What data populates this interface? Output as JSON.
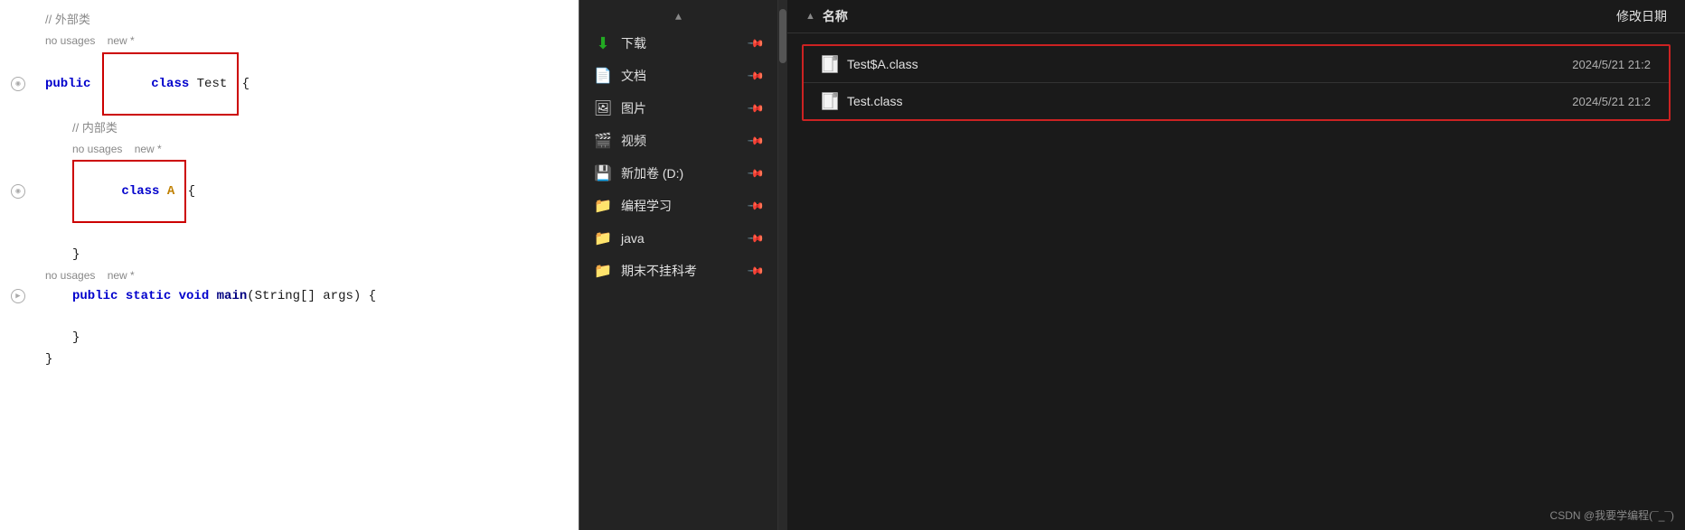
{
  "editor": {
    "lines": [
      {
        "id": 1,
        "type": "comment",
        "text": "// 外部类",
        "indent": 0
      },
      {
        "id": 2,
        "type": "hint",
        "text": "no usages   new *"
      },
      {
        "id": 3,
        "type": "code-public-class",
        "text_before": "public ",
        "keyword_class": "class",
        "class_name": " Test ",
        "highlight_class": true,
        "text_after": "{",
        "indent": 0
      },
      {
        "id": 4,
        "type": "comment-inner",
        "text": "// 内部类",
        "indent": 1
      },
      {
        "id": 5,
        "type": "hint",
        "text": "no usages   new *"
      },
      {
        "id": 6,
        "type": "inner-class",
        "keyword_class": "class",
        "class_name": " A ",
        "highlight": true,
        "text_after": "{",
        "indent": 1
      },
      {
        "id": 7,
        "type": "empty",
        "indent": 0
      },
      {
        "id": 8,
        "type": "closing",
        "text": "}",
        "indent": 1
      },
      {
        "id": 9,
        "type": "hint",
        "text": "no usages   new *"
      },
      {
        "id": 10,
        "type": "main-method",
        "text": "public static void main(String[] args) {",
        "indent": 1
      },
      {
        "id": 11,
        "type": "empty",
        "indent": 0
      },
      {
        "id": 12,
        "type": "closing",
        "text": "}",
        "indent": 1
      },
      {
        "id": 13,
        "type": "closing",
        "text": "}",
        "indent": 0
      }
    ]
  },
  "sidebar": {
    "items": [
      {
        "id": "download",
        "icon": "⬇",
        "icon_color": "#22aa22",
        "label": "下载",
        "pinned": true
      },
      {
        "id": "documents",
        "icon": "📄",
        "label": "文档",
        "pinned": true
      },
      {
        "id": "pictures",
        "icon": "🖼",
        "label": "图片",
        "pinned": true
      },
      {
        "id": "videos",
        "icon": "🎬",
        "label": "视频",
        "pinned": true
      },
      {
        "id": "drive-d",
        "icon": "💾",
        "label": "新加卷 (D:)",
        "pinned": true
      },
      {
        "id": "programming",
        "icon": "📁",
        "label": "编程学习",
        "pinned": true
      },
      {
        "id": "java",
        "icon": "📁",
        "label": "java",
        "pinned": true
      },
      {
        "id": "exam",
        "icon": "📁",
        "label": "期末不挂科考",
        "pinned": true
      }
    ]
  },
  "file_panel": {
    "header": {
      "name_label": "名称",
      "date_label": "修改日期"
    },
    "highlighted_files": [
      {
        "name": "Test$A.class",
        "date": "2024/5/21 21:2"
      },
      {
        "name": "Test.class",
        "date": "2024/5/21 21:2"
      }
    ]
  },
  "watermark": "CSDN @我要学编程(¯_¯)"
}
